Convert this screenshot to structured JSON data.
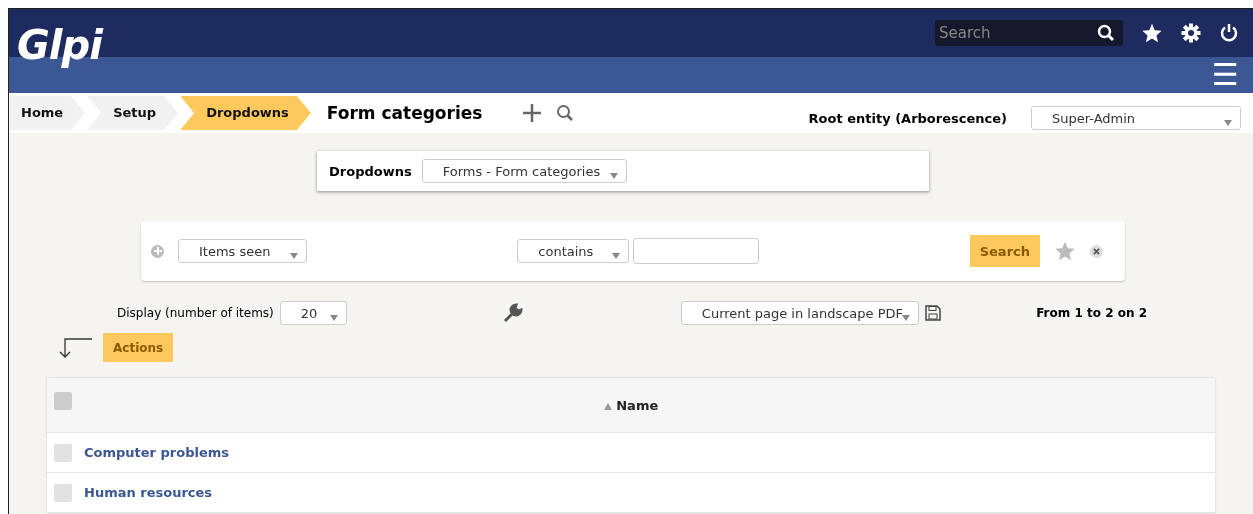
{
  "logo": "Glpi",
  "top_search": {
    "placeholder": "Search"
  },
  "menu_icon": "☰",
  "breadcrumb": [
    {
      "label": "Home",
      "selected": false
    },
    {
      "label": "Setup",
      "selected": false
    },
    {
      "label": "Dropdowns",
      "selected": true
    }
  ],
  "page_title": "Form categories",
  "entity": "Root entity (Arborescence)",
  "profile": "Super-Admin",
  "dropdown_chooser": {
    "label": "Dropdowns",
    "value": "Forms - Form categories"
  },
  "search_criteria": {
    "field": "Items seen",
    "operator": "contains",
    "button": "Search"
  },
  "display": {
    "label": "Display (number of items)",
    "value": "20"
  },
  "export": "Current page in landscape PDF",
  "pager": "From 1 to 2 on 2",
  "actions": "Actions",
  "table": {
    "header": {
      "label": "Name",
      "checked": false
    },
    "rows": [
      {
        "name": "Computer problems",
        "checked": false
      },
      {
        "name": "Human resources",
        "checked": false
      }
    ]
  }
}
